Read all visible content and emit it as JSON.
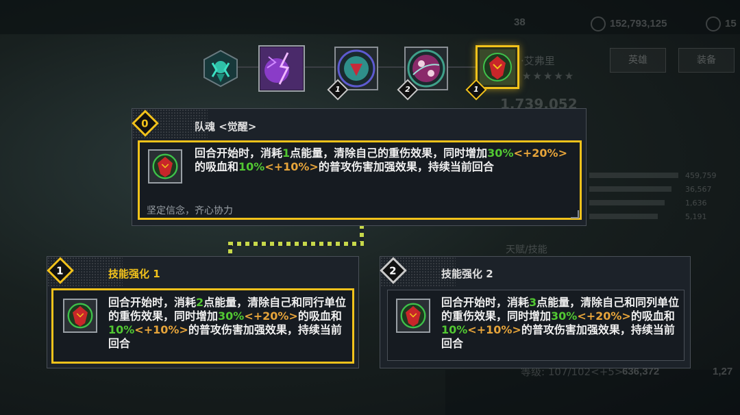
{
  "background": {
    "stats": [
      "38",
      "152,793,125",
      "15"
    ],
    "tabs": [
      "英雄",
      "装备"
    ],
    "hero_name": "·艾弗里",
    "stars": "★★★★★",
    "power": "1,739,052",
    "attr_values": [
      "459,759",
      "36,567",
      "1,636",
      "5,191"
    ],
    "talent_label": "天赋/技能",
    "level_text": "等级: 107/102<+5>",
    "bottom_value": "636,372",
    "bottom_value2": "1,27"
  },
  "skills": [
    {
      "icon": "teal-demon-hex-icon"
    },
    {
      "icon": "purple-lightning-icon"
    },
    {
      "icon": "green-mask-orb-icon",
      "level": "1"
    },
    {
      "icon": "chain-skull-orb-icon",
      "level": "2"
    },
    {
      "icon": "red-crest-icon",
      "level": "1",
      "selected": true
    }
  ],
  "main_panel": {
    "number": "0",
    "title": "队魂 <觉醒>",
    "desc_parts": [
      {
        "t": "回合开始时，消耗",
        "c": ""
      },
      {
        "t": "1",
        "c": "g"
      },
      {
        "t": "点能量，清除自己的重伤效果，同时增加",
        "c": ""
      },
      {
        "t": "30%",
        "c": "g"
      },
      {
        "t": "<+20%>",
        "c": "o"
      },
      {
        "t": "的吸血和",
        "c": ""
      },
      {
        "t": "10%",
        "c": "g"
      },
      {
        "t": "<+10%>",
        "c": "o"
      },
      {
        "t": "的普攻伤害加强效果，持续当前回合",
        "c": ""
      }
    ],
    "flavor": "坚定信念，齐心协力"
  },
  "left_panel": {
    "number": "1",
    "title": "技能强化 1",
    "desc_parts": [
      {
        "t": "回合开始时，消耗",
        "c": ""
      },
      {
        "t": "2",
        "c": "g"
      },
      {
        "t": "点能量，清除自己和同行单位的重伤效果，同时增加",
        "c": ""
      },
      {
        "t": "30%",
        "c": "g"
      },
      {
        "t": "<+20%>",
        "c": "o"
      },
      {
        "t": "的吸血和",
        "c": ""
      },
      {
        "t": "10%",
        "c": "g"
      },
      {
        "t": "<+10%>",
        "c": "o"
      },
      {
        "t": "的普攻伤害加强效果，持续当前回合",
        "c": ""
      }
    ]
  },
  "right_panel": {
    "number": "2",
    "title": "技能强化 2",
    "desc_parts": [
      {
        "t": "回合开始时，消耗",
        "c": ""
      },
      {
        "t": "3",
        "c": "g"
      },
      {
        "t": "点能量，清除自己和同列单位的重伤效果，同时增加",
        "c": ""
      },
      {
        "t": "30%",
        "c": "g"
      },
      {
        "t": "<+20%>",
        "c": "o"
      },
      {
        "t": "的吸血和",
        "c": ""
      },
      {
        "t": "10%",
        "c": "g"
      },
      {
        "t": "<+10%>",
        "c": "o"
      },
      {
        "t": "的普攻伤害加强效果，持续当前回合",
        "c": ""
      }
    ]
  },
  "colors": {
    "accent": "#f2c21b",
    "highlight_green": "#52c832",
    "highlight_orange": "#e6a43a"
  }
}
